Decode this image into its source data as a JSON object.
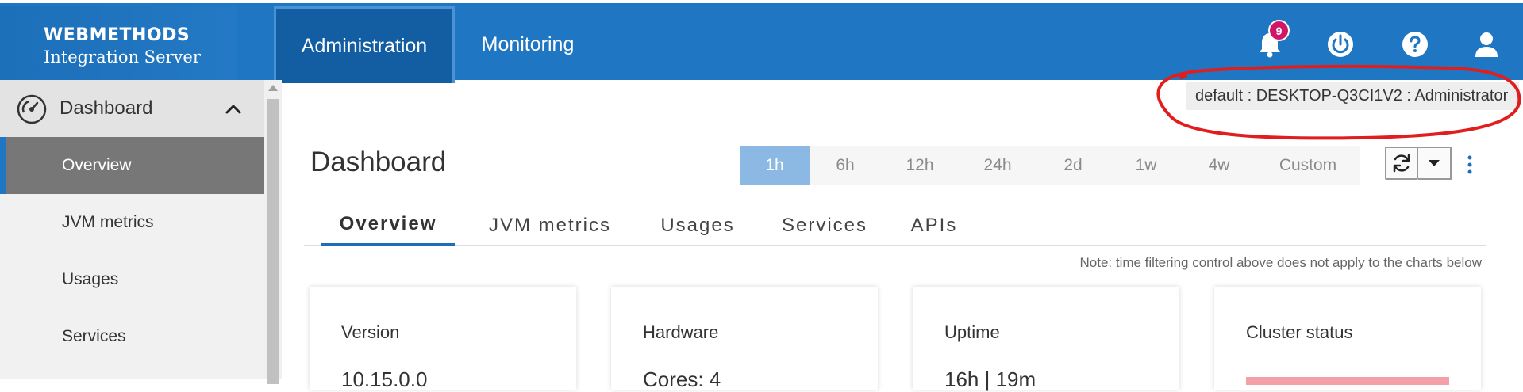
{
  "brand": {
    "title": "WEBMETHODS",
    "subtitle": "Integration Server"
  },
  "nav": {
    "tabs": [
      {
        "label": "Administration",
        "active": true
      },
      {
        "label": "Monitoring",
        "active": false
      }
    ]
  },
  "header_icons": {
    "notifications": {
      "icon": "bell-icon",
      "count": "9"
    },
    "power": "power-icon",
    "help": "help-icon",
    "user": "user-icon"
  },
  "colors": {
    "header": "#1f76c2",
    "active_tab": "#135ea3",
    "accent": "#1f6eb5",
    "badge": "#d1166a",
    "time_active": "#8bb9e4"
  },
  "sidebar": {
    "section": {
      "label": "Dashboard",
      "icon": "speedometer-icon",
      "expanded": true
    },
    "items": [
      {
        "label": "Overview",
        "active": true
      },
      {
        "label": "JVM metrics",
        "active": false
      },
      {
        "label": "Usages",
        "active": false
      },
      {
        "label": "Services",
        "active": false
      }
    ]
  },
  "user_info": "default : DESKTOP-Q3CI1V2 : Administrator",
  "page": {
    "title": "Dashboard"
  },
  "time_range": {
    "options": [
      "1h",
      "6h",
      "12h",
      "24h",
      "2d",
      "1w",
      "4w",
      "Custom"
    ],
    "selected": "1h"
  },
  "dashboard_tabs": [
    "Overview",
    "JVM metrics",
    "Usages",
    "Services",
    "APIs"
  ],
  "note": "Note: time filtering control above does not apply to the charts below",
  "cards": [
    {
      "title": "Version",
      "value": "10.15.0.0"
    },
    {
      "title": "Hardware",
      "value": "Cores: 4"
    },
    {
      "title": "Uptime",
      "value": "16h | 19m"
    },
    {
      "title": "Cluster status",
      "value": ""
    }
  ]
}
